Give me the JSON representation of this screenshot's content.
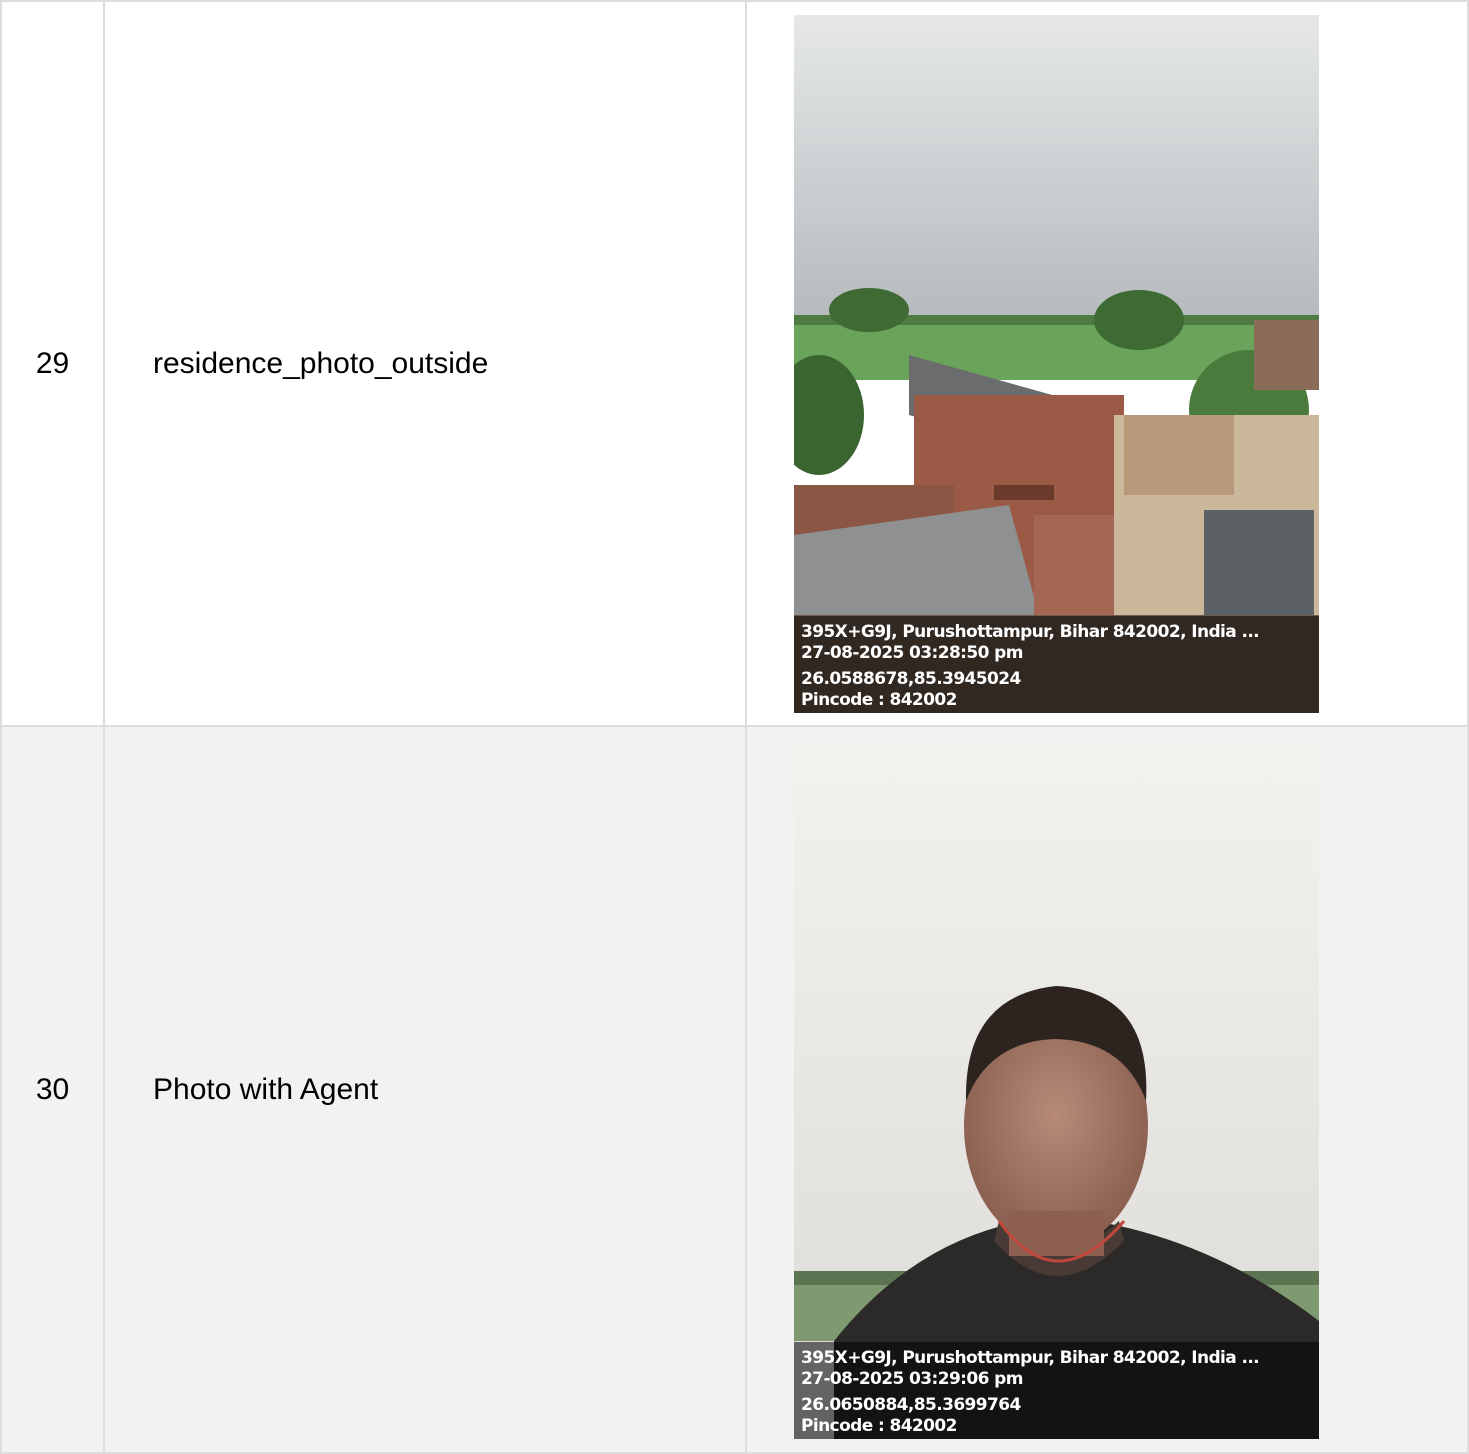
{
  "rows": [
    {
      "number": "29",
      "label": "residence_photo_outside",
      "photo": {
        "address": "395X+G9J, Purushottampur, Bihar 842002, India ...",
        "timestamp": "27-08-2025 03:28:50 pm",
        "coordinates": "26.0588678,85.3945024",
        "pincode": "Pincode : 842002"
      }
    },
    {
      "number": "30",
      "label": "Photo with Agent",
      "photo": {
        "address": "395X+G9J, Purushottampur, Bihar 842002, India ...",
        "timestamp": "27-08-2025 03:29:06 pm",
        "coordinates": "26.0650884,85.3699764",
        "pincode": "Pincode : 842002"
      }
    }
  ],
  "colors": {
    "border": "#dddddd",
    "row_alt_background": "#f2f2f2",
    "overlay_text": "#ffffff"
  }
}
